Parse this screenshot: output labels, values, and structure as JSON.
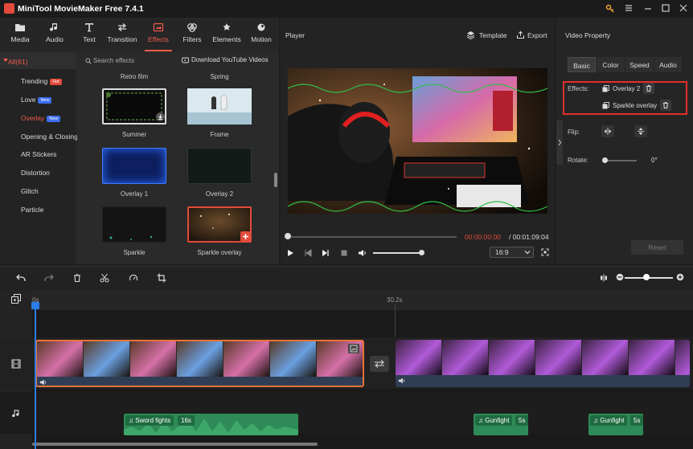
{
  "window": {
    "title": "MiniTool MovieMaker Free 7.4.1"
  },
  "top_tabs": [
    {
      "label": "Media"
    },
    {
      "label": "Audio"
    },
    {
      "label": "Text"
    },
    {
      "label": "Transition"
    },
    {
      "label": "Effects",
      "active": true
    },
    {
      "label": "Filters"
    },
    {
      "label": "Elements"
    },
    {
      "label": "Motion"
    }
  ],
  "categories": {
    "all_label": "All(61)",
    "items": [
      {
        "label": "Trending",
        "badge": "Hot"
      },
      {
        "label": "Love",
        "badge": "New"
      },
      {
        "label": "Overlay",
        "badge": "New",
        "active": true
      },
      {
        "label": "Opening & Closing"
      },
      {
        "label": "AR Stickers"
      },
      {
        "label": "Distortion"
      },
      {
        "label": "Glitch"
      },
      {
        "label": "Particle"
      }
    ]
  },
  "effects_browser": {
    "search_placeholder": "Search effects",
    "download_label": "Download YouTube Videos",
    "partial_labels": [
      "Retro film",
      "Spring"
    ],
    "items": [
      {
        "label": "Summer"
      },
      {
        "label": "Frame"
      },
      {
        "label": "Overlay 1"
      },
      {
        "label": "Overlay 2"
      },
      {
        "label": "Sparkle"
      },
      {
        "label": "Sparkle overlay"
      }
    ]
  },
  "player": {
    "title": "Player",
    "template_label": "Template",
    "export_label": "Export",
    "time_current": "00:00:00:00",
    "time_total": "/ 00:01:09:04",
    "aspect_ratio": "16:9",
    "progress": 0.0,
    "volume": 1.0
  },
  "property_panel": {
    "title": "Video Property",
    "tabs": [
      {
        "label": "Basic",
        "active": true
      },
      {
        "label": "Color"
      },
      {
        "label": "Speed"
      },
      {
        "label": "Audio"
      }
    ],
    "effects_label": "Effects:",
    "effects": [
      {
        "label": "Overlay 2"
      },
      {
        "label": "Sparkle overlay"
      }
    ],
    "flip_label": "Flip:",
    "rotate_label": "Rotate:",
    "rotate_value": "0°",
    "reset_label": "Reset"
  },
  "timeline": {
    "ruler": [
      "0s",
      "30.2s"
    ],
    "audio_clips": [
      {
        "label": "Sword fights",
        "duration": "16s"
      },
      {
        "label": "Gunfight",
        "duration": "5s"
      },
      {
        "label": "Gunfight",
        "duration": "5s"
      }
    ]
  },
  "colors": {
    "accent": "#f05a4a",
    "highlight_box": "#e0302a",
    "playhead": "#2b7de9",
    "audio_clip": "#2e8b57",
    "selected_clip_border": "#e8733a"
  }
}
